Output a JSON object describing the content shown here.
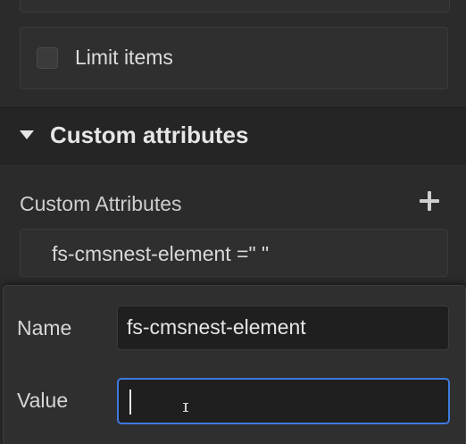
{
  "limit": {
    "label": "Limit items",
    "checked": false
  },
  "section": {
    "title": "Custom attributes",
    "expanded": true
  },
  "attributes": {
    "label": "Custom Attributes",
    "items": [
      {
        "display": "fs-cmsnest-element =\" \""
      }
    ]
  },
  "popover": {
    "name_label": "Name",
    "name_value": "fs-cmsnest-element",
    "value_label": "Value",
    "value_value": ""
  },
  "icons": {
    "caret": "caret-down-icon",
    "add": "plus-icon",
    "cursor": "ibeam-cursor-icon"
  },
  "colors": {
    "focus_border": "#3d7ae0",
    "panel_bg": "#2b2b2b"
  }
}
